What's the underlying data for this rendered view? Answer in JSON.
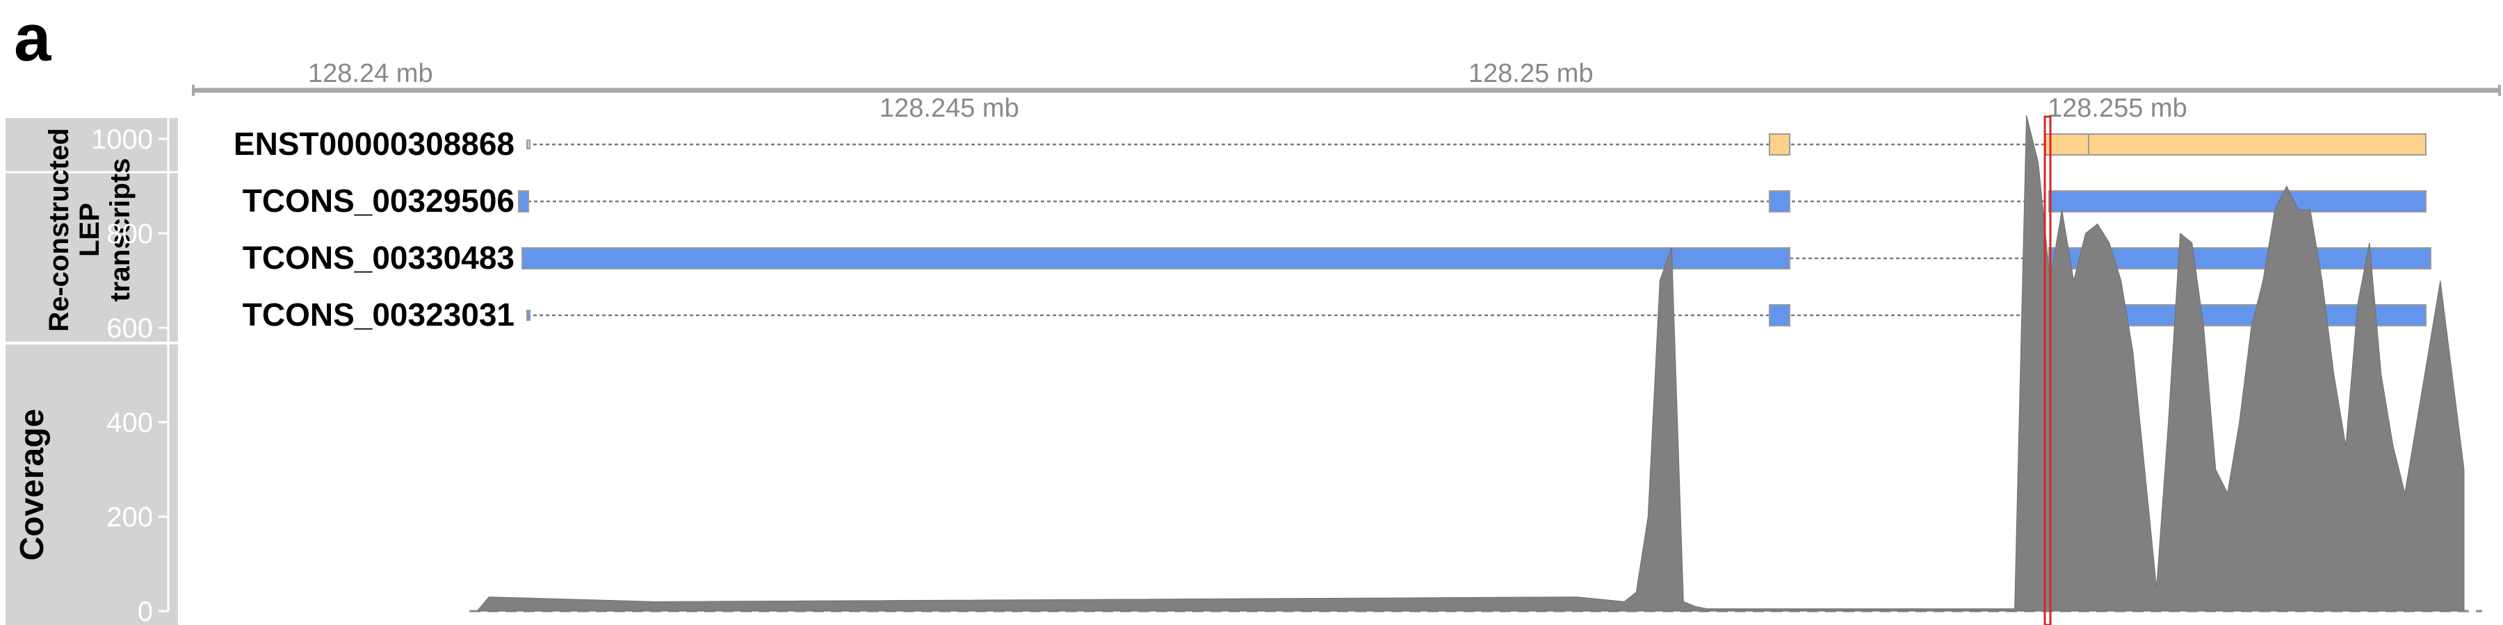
{
  "panel_label": "a",
  "axis": {
    "tick_labels_top": [
      "128.24 mb",
      "128.25 mb"
    ],
    "tick_labels_bottom": [
      "128.245 mb",
      "128.255 mb"
    ]
  },
  "transcript_panel": {
    "title_lines": [
      "Re-constructed",
      "LEP",
      "transcripts"
    ],
    "transcripts": [
      {
        "name": "ENST00000308868",
        "color": "#fdd28a"
      },
      {
        "name": "TCONS_00329506",
        "color": "#6495ed"
      },
      {
        "name": "TCONS_00330483",
        "color": "#6495ed"
      },
      {
        "name": "TCONS_00323031",
        "color": "#6495ed"
      }
    ]
  },
  "coverage_panel": {
    "title": "Coverage",
    "y_ticks": [
      "1000",
      "800",
      "600",
      "400",
      "200",
      "0"
    ],
    "color": "#808080"
  },
  "highlight_color": "#d62728",
  "chart_data": {
    "type": "area",
    "ylim": [
      0,
      1100
    ],
    "xlim_mb": [
      128.2371,
      128.2566
    ],
    "x": [
      128.2395,
      128.2396,
      128.241,
      128.245,
      128.2488,
      128.2492,
      128.2493,
      128.2494,
      128.2495,
      128.2496,
      128.2497,
      128.2498,
      128.2499,
      128.25,
      128.251,
      128.2525,
      128.2526,
      128.2527,
      128.2528,
      128.2529,
      128.253,
      128.2531,
      128.2532,
      128.2533,
      128.2534,
      128.2535,
      128.2536,
      128.2537,
      128.2538,
      128.2539,
      128.254,
      128.2541,
      128.2542,
      128.2543,
      128.2544,
      128.2545,
      128.2546,
      128.2547,
      128.2548,
      128.2549,
      128.255,
      128.2551,
      128.2552,
      128.2553,
      128.2554,
      128.2555,
      128.2556,
      128.2557,
      128.2558,
      128.2559,
      128.256,
      128.2561,
      128.2562,
      128.2563
    ],
    "values": [
      0,
      30,
      20,
      25,
      30,
      20,
      40,
      200,
      700,
      770,
      20,
      10,
      5,
      5,
      5,
      5,
      1050,
      950,
      700,
      850,
      700,
      800,
      820,
      780,
      700,
      550,
      300,
      50,
      400,
      800,
      780,
      600,
      300,
      250,
      400,
      600,
      700,
      850,
      900,
      850,
      850,
      700,
      500,
      350,
      650,
      780,
      500,
      350,
      250,
      400,
      550,
      700,
      500,
      300
    ]
  }
}
